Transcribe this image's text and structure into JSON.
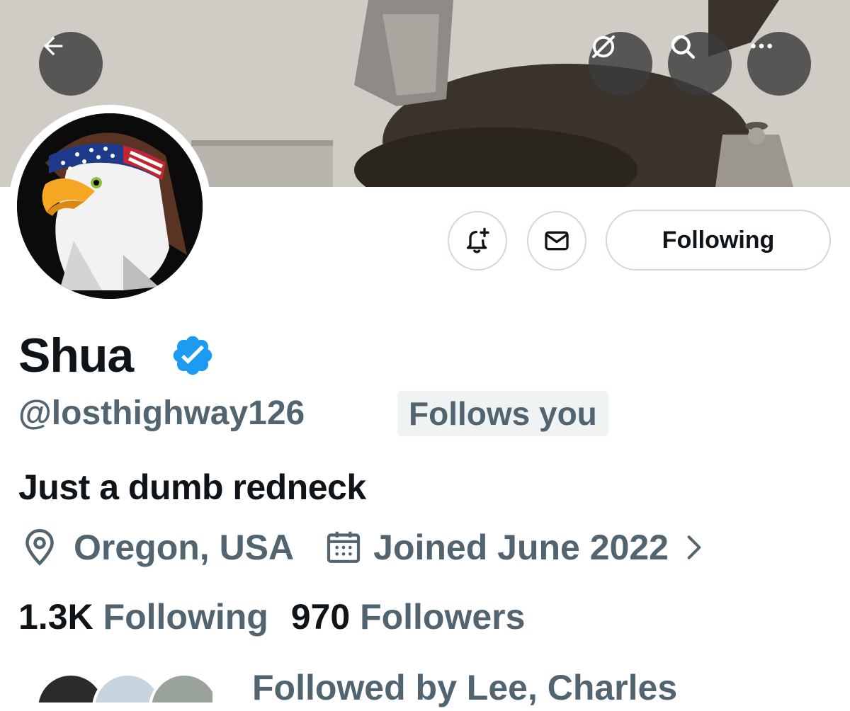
{
  "header": {
    "back_icon": "arrow-left-icon",
    "grok_icon": "grok-slash-circle-icon",
    "search_icon": "search-icon",
    "more_icon": "more-horizontal-icon"
  },
  "actions": {
    "notify_icon": "bell-plus-icon",
    "message_icon": "envelope-icon",
    "following_label": "Following"
  },
  "profile": {
    "name": "Shua",
    "verified": true,
    "handle": "@losthighway126",
    "follows_you": "Follows you",
    "bio": "Just a dumb redneck",
    "location": "Oregon, USA",
    "joined": "Joined June 2022",
    "following_count": "1.3K",
    "following_label": "Following",
    "followers_count": "970",
    "followers_label": "Followers",
    "followed_by": "Followed by Lee, Charles"
  },
  "colors": {
    "text_primary": "#0f1419",
    "text_secondary": "#536471",
    "verified_blue": "#1d9bf0",
    "border": "#cfd9de"
  }
}
